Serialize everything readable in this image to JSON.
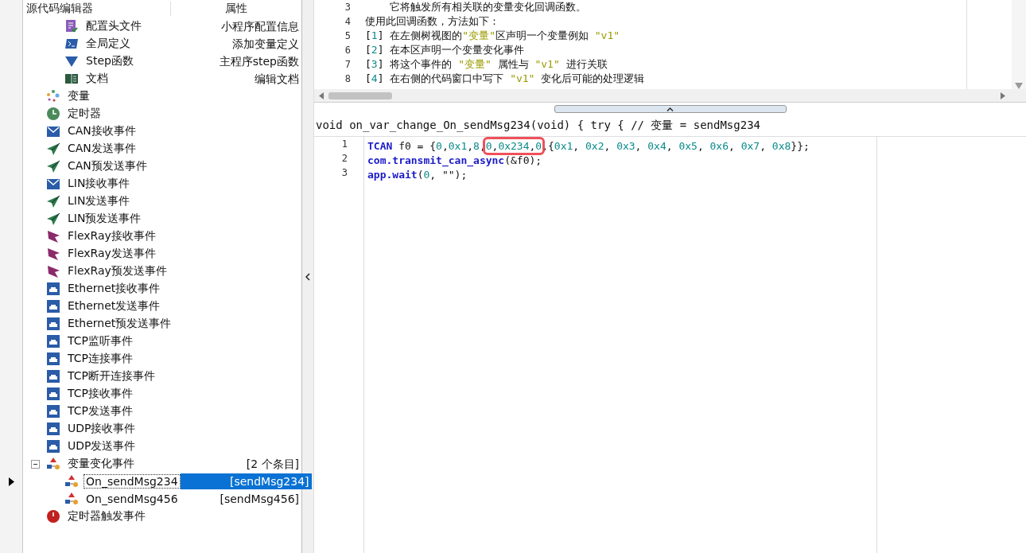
{
  "tree_header": {
    "columns": [
      "源代码编辑器",
      "属性"
    ]
  },
  "tree": [
    {
      "children": [
        {
          "label": "配置头文件",
          "property": "小程序配置信息",
          "kind": "config"
        },
        {
          "label": "全局定义",
          "property": "添加变量定义",
          "kind": "terminal"
        },
        {
          "label": "Step函数",
          "property": "主程序step函数",
          "kind": "triangle"
        },
        {
          "label": "文档",
          "property": "编辑文档",
          "kind": "book"
        }
      ]
    },
    {
      "label": "变量",
      "kind": "dots"
    },
    {
      "label": "定时器",
      "kind": "clock"
    },
    {
      "label": "CAN接收事件",
      "kind": "mail"
    },
    {
      "label": "CAN发送事件",
      "kind": "send"
    },
    {
      "label": "CAN预发送事件",
      "kind": "send"
    },
    {
      "label": "LIN接收事件",
      "kind": "mail"
    },
    {
      "label": "LIN发送事件",
      "kind": "send"
    },
    {
      "label": "LIN预发送事件",
      "kind": "send"
    },
    {
      "label": "FlexRay接收事件",
      "kind": "flex"
    },
    {
      "label": "FlexRay发送事件",
      "kind": "flex"
    },
    {
      "label": "FlexRay预发送事件",
      "kind": "flex"
    },
    {
      "label": "Ethernet接收事件",
      "kind": "net"
    },
    {
      "label": "Ethernet发送事件",
      "kind": "net"
    },
    {
      "label": "Ethernet预发送事件",
      "kind": "net"
    },
    {
      "label": "TCP监听事件",
      "kind": "net"
    },
    {
      "label": "TCP连接事件",
      "kind": "net"
    },
    {
      "label": "TCP断开连接事件",
      "kind": "net"
    },
    {
      "label": "TCP接收事件",
      "kind": "net"
    },
    {
      "label": "TCP发送事件",
      "kind": "net"
    },
    {
      "label": "UDP接收事件",
      "kind": "net"
    },
    {
      "label": "UDP发送事件",
      "kind": "net"
    },
    {
      "label": "变量变化事件",
      "property": "[2 个条目]",
      "kind": "var",
      "expanded": true,
      "children": [
        {
          "label": "On_sendMsg234",
          "property": "[sendMsg234]",
          "kind": "var",
          "selected": true
        },
        {
          "label": "On_sendMsg456",
          "property": "[sendMsg456]",
          "kind": "var",
          "selected": false
        }
      ]
    },
    {
      "label": "定时器触发事件",
      "kind": "alarm"
    }
  ],
  "doc_editor": {
    "lines": [
      {
        "number": "3",
        "tokens": [
          {
            "text": "    它将触发所有相关联的变量变化回调函数。",
            "kind": "plain"
          }
        ]
      },
      {
        "number": "4",
        "tokens": [
          {
            "text": "使用此回调函数，方法如下：",
            "kind": "plain"
          }
        ]
      },
      {
        "number": "5",
        "tokens": [
          {
            "text": "[",
            "kind": "plain"
          },
          {
            "text": "1",
            "kind": "number"
          },
          {
            "text": "] 在左侧树视图的",
            "kind": "plain"
          },
          {
            "text": "\"变量\"",
            "kind": "string"
          },
          {
            "text": "区声明一个变量例如 ",
            "kind": "plain"
          },
          {
            "text": "\"v1\"",
            "kind": "string"
          }
        ]
      },
      {
        "number": "6",
        "tokens": [
          {
            "text": "[",
            "kind": "plain"
          },
          {
            "text": "2",
            "kind": "number"
          },
          {
            "text": "] 在本区声明一个变量变化事件",
            "kind": "plain"
          }
        ]
      },
      {
        "number": "7",
        "tokens": [
          {
            "text": "[",
            "kind": "plain"
          },
          {
            "text": "3",
            "kind": "number"
          },
          {
            "text": "] 将这个事件的 ",
            "kind": "plain"
          },
          {
            "text": "\"变量\"",
            "kind": "string"
          },
          {
            "text": " 属性与 ",
            "kind": "plain"
          },
          {
            "text": "\"v1\"",
            "kind": "string"
          },
          {
            "text": " 进行关联",
            "kind": "plain"
          }
        ]
      },
      {
        "number": "8",
        "tokens": [
          {
            "text": "[",
            "kind": "plain"
          },
          {
            "text": "4",
            "kind": "number"
          },
          {
            "text": "] 在右侧的代码窗口中写下 ",
            "kind": "plain"
          },
          {
            "text": "\"v1\"",
            "kind": "string"
          },
          {
            "text": " 变化后可能的处理逻辑",
            "kind": "plain"
          }
        ]
      }
    ]
  },
  "function_header": "void on_var_change_On_sendMsg234(void) { try { // 变量 = sendMsg234",
  "code_editor": {
    "lines": [
      {
        "number": "1",
        "tokens": [
          {
            "text": "TCAN",
            "kind": "keyword"
          },
          {
            "text": " f0 = {",
            "kind": "plain"
          },
          {
            "text": "0",
            "kind": "number"
          },
          {
            "text": ",",
            "kind": "plain"
          },
          {
            "text": "0x1",
            "kind": "number"
          },
          {
            "text": ",",
            "kind": "plain"
          },
          {
            "text": "8",
            "kind": "number"
          },
          {
            "text": ",",
            "kind": "plain"
          },
          {
            "text": "0",
            "kind": "number",
            "boxed": true
          },
          {
            "text": ",",
            "kind": "plain",
            "boxed": true
          },
          {
            "text": "0x234",
            "kind": "number",
            "boxed": true
          },
          {
            "text": ",",
            "kind": "plain",
            "boxed": true
          },
          {
            "text": "0",
            "kind": "number",
            "boxed": true
          },
          {
            "text": ",{",
            "kind": "plain"
          },
          {
            "text": "0x1",
            "kind": "number"
          },
          {
            "text": ", ",
            "kind": "plain"
          },
          {
            "text": "0x2",
            "kind": "number"
          },
          {
            "text": ", ",
            "kind": "plain"
          },
          {
            "text": "0x3",
            "kind": "number"
          },
          {
            "text": ", ",
            "kind": "plain"
          },
          {
            "text": "0x4",
            "kind": "number"
          },
          {
            "text": ", ",
            "kind": "plain"
          },
          {
            "text": "0x5",
            "kind": "number"
          },
          {
            "text": ", ",
            "kind": "plain"
          },
          {
            "text": "0x6",
            "kind": "number"
          },
          {
            "text": ", ",
            "kind": "plain"
          },
          {
            "text": "0x7",
            "kind": "number"
          },
          {
            "text": ", ",
            "kind": "plain"
          },
          {
            "text": "0x8",
            "kind": "number"
          },
          {
            "text": "}};",
            "kind": "plain"
          }
        ]
      },
      {
        "number": "2",
        "tokens": [
          {
            "text": "com.transmit_can_async",
            "kind": "keyword"
          },
          {
            "text": "(&f0);",
            "kind": "plain"
          }
        ]
      },
      {
        "number": "3",
        "tokens": [
          {
            "text": "app.wait",
            "kind": "keyword"
          },
          {
            "text": "(",
            "kind": "plain"
          },
          {
            "text": "0",
            "kind": "number"
          },
          {
            "text": ", ",
            "kind": "plain"
          },
          {
            "text": "\"\"",
            "kind": "plain"
          },
          {
            "text": ");",
            "kind": "plain"
          }
        ]
      }
    ]
  }
}
